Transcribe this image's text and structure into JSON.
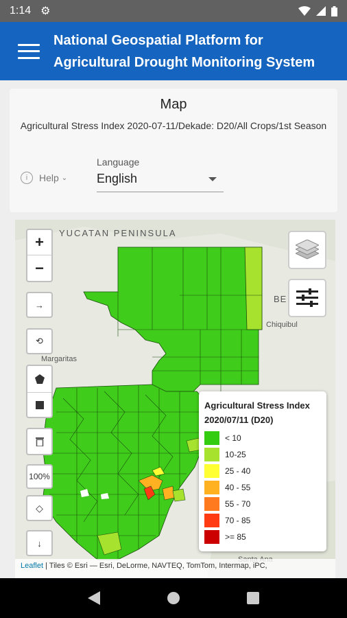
{
  "status": {
    "time": "1:14"
  },
  "appbar": {
    "title_line1": "National Geospatial Platform for",
    "title_line2": "Agricultural Drought Monitoring System"
  },
  "page": {
    "heading": "Map",
    "subtitle": "Agricultural Stress Index 2020-07-11/Dekade: D20/All Crops/1st Season",
    "help_label": "Help",
    "language_label": "Language",
    "language_value": "English"
  },
  "map": {
    "zoom_in": "+",
    "zoom_out": "−",
    "btn_next": "→",
    "btn_rotate": "⟲",
    "btn_zoom_pct": "100%",
    "btn_download": "↓",
    "place_labels": [
      "YUCATAN PENINSULA",
      "BE",
      "Chiquibul",
      "Margaritas",
      "Santa Ana"
    ],
    "attribution_link": "Leaflet",
    "attribution_text": " | Tiles © Esri — Esri, DeLorme, NAVTEQ, TomTom, Intermap, iPC,"
  },
  "legend": {
    "title_line1": "Agricultural Stress Index",
    "title_line2": "2020/07/11 (D20)",
    "items": [
      {
        "label": "< 10",
        "color": "#33cc11"
      },
      {
        "label": "10-25",
        "color": "#a6e22e"
      },
      {
        "label": "25 - 40",
        "color": "#ffff33"
      },
      {
        "label": "40 - 55",
        "color": "#ffb121"
      },
      {
        "label": "55 - 70",
        "color": "#ff7a1f"
      },
      {
        "label": "70 - 85",
        "color": "#ff3b14"
      },
      {
        "label": ">= 85",
        "color": "#cc0000"
      }
    ]
  },
  "icons": {
    "settings": "gear-icon",
    "wifi": "wifi-icon",
    "signal": "signal-icon",
    "battery": "battery-icon"
  }
}
